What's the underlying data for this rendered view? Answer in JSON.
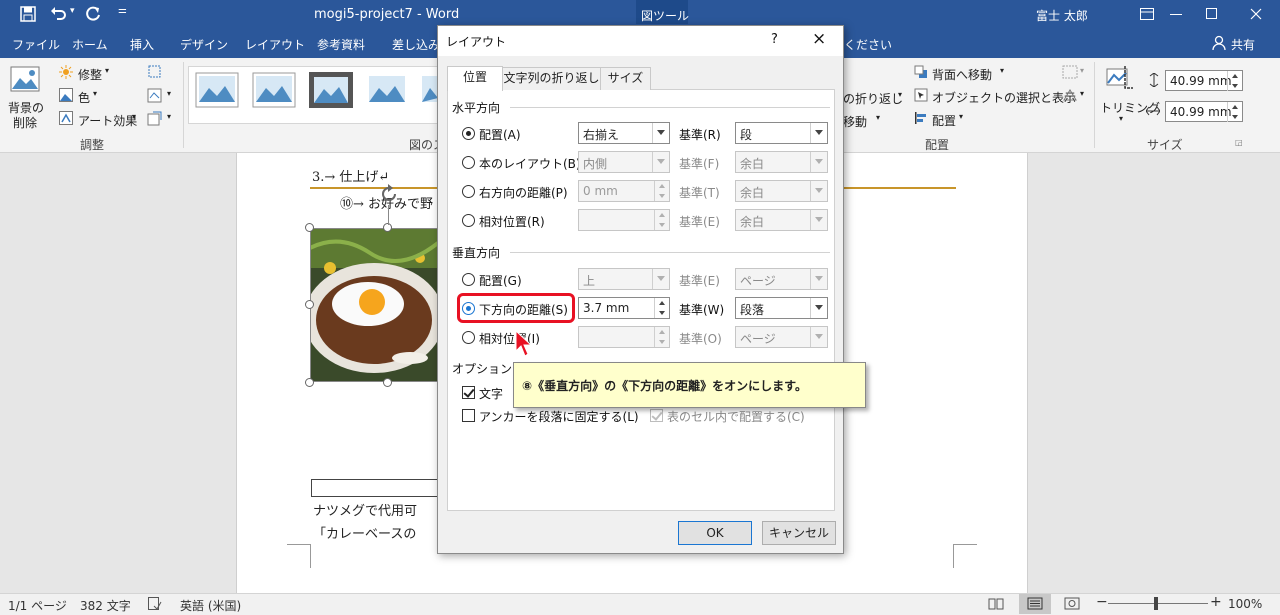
{
  "app": {
    "title": "mogi5-project7  -  Word",
    "context_tab": "図ツール",
    "user": "富士 太郎",
    "share": "共有",
    "tell_me_tail": "ください"
  },
  "menu": [
    "ファイル",
    "ホーム",
    "挿入",
    "デザイン",
    "レイアウト",
    "参考資料",
    "差し込み"
  ],
  "ribbon": {
    "remove_bg": "背景の\n削除",
    "remove_bg_l1": "背景の",
    "remove_bg_l2": "削除",
    "corrections": "修整",
    "color": "色",
    "art_effects": "アート効果",
    "group_adjust": "調整",
    "group_styles": "図のス",
    "wrap_text": "の折り返し",
    "move_with": "移動",
    "send_backward": "背面へ移動",
    "selection_pane": "オブジェクトの選択と表示",
    "align": "配置",
    "group_arrange": "配置",
    "crop": "トリミング",
    "height": "40.99 mm",
    "width": "40.99 mm",
    "group_size": "サイズ"
  },
  "document": {
    "heading": "3.→ 仕上げ↵",
    "item10": "⑩→ お好みで野",
    "nutmeg": "ナツメグで代用可",
    "curry_base": "「カレーベースの"
  },
  "dialog": {
    "title": "レイアウト",
    "help": "?",
    "close": "×",
    "tabs": [
      "位置",
      "文字列の折り返し",
      "サイズ"
    ],
    "horizontal": {
      "section": "水平方向",
      "rows": [
        {
          "label": "配置(A)",
          "value": "右揃え",
          "base_label": "基準(R)",
          "base": "段"
        },
        {
          "label": "本のレイアウト(B)",
          "value": "内側",
          "base_label": "基準(F)",
          "base": "余白"
        },
        {
          "label": "右方向の距離(P)",
          "value": "0 mm",
          "base_label": "基準(T)",
          "base": "余白"
        },
        {
          "label": "相対位置(R)",
          "value": "",
          "base_label": "基準(E)",
          "base": "余白"
        }
      ]
    },
    "vertical": {
      "section": "垂直方向",
      "rows": [
        {
          "label": "配置(G)",
          "value": "上",
          "base_label": "基準(E)",
          "base": "ページ"
        },
        {
          "label": "下方向の距離(S)",
          "value": "3.7 mm",
          "base_label": "基準(W)",
          "base": "段落"
        },
        {
          "label": "相対位置(I)",
          "value": "",
          "base_label": "基準(O)",
          "base": "ページ"
        }
      ]
    },
    "options": {
      "section": "オプション",
      "move_with_text": "文字",
      "lock_anchor": "アンカーを段落に固定する(L)",
      "layout_in_cell": "表のセル内で配置する(C)"
    },
    "ok": "OK",
    "cancel": "キャンセル"
  },
  "callout": {
    "text": "⑧《垂直方向》の《下方向の距離》をオンにします。"
  },
  "status": {
    "page": "1/1 ページ",
    "words": "382 文字",
    "language": "英語 (米国)",
    "zoom": "100%"
  },
  "colors": {
    "accent": "#2b579a",
    "highlight": "#e81123",
    "callout_bg": "#ffffcc"
  }
}
